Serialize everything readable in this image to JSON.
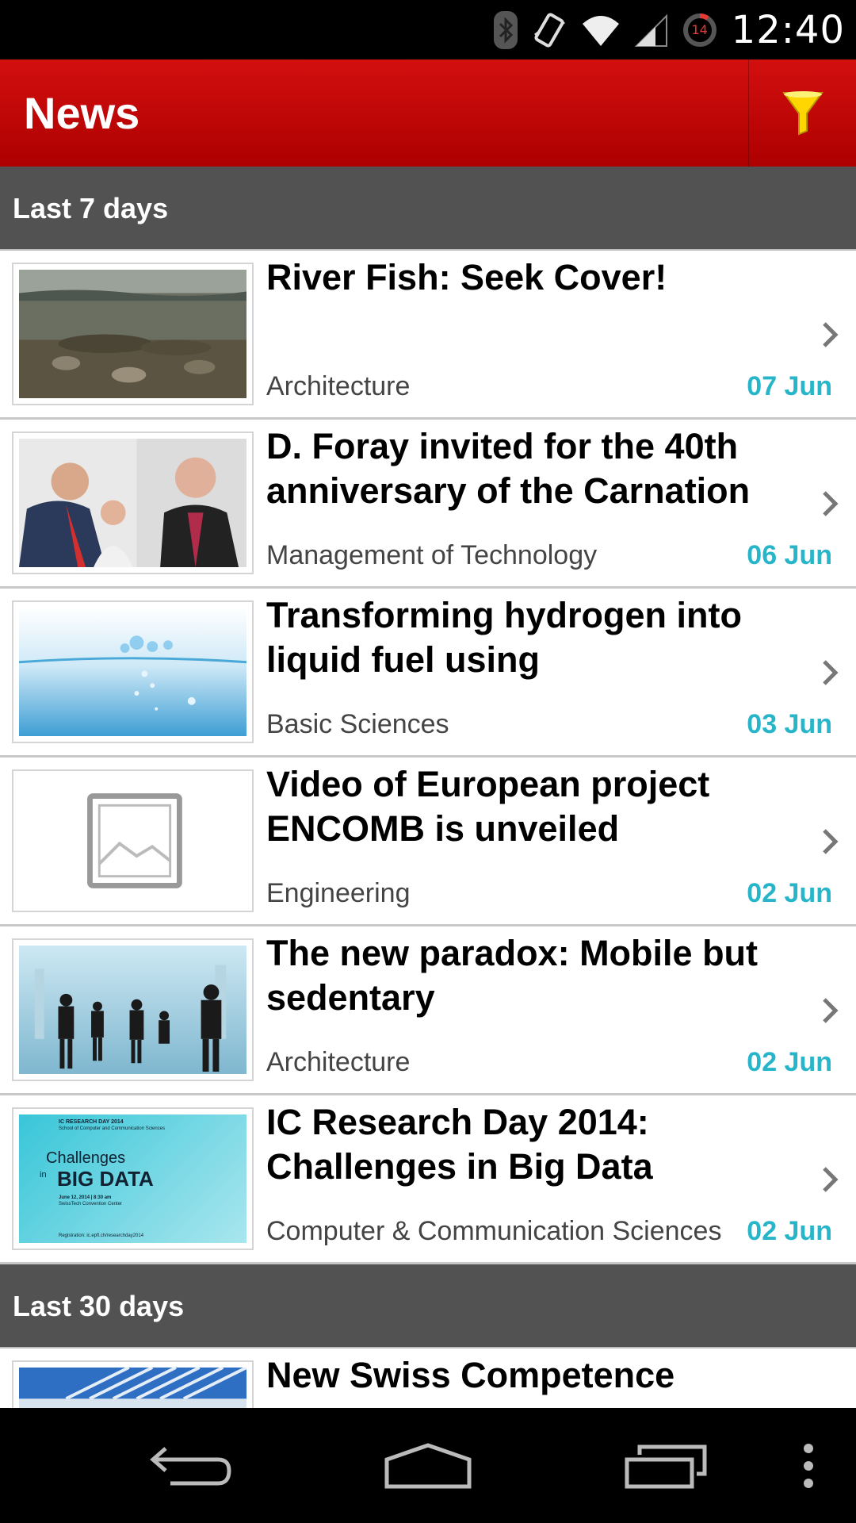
{
  "status_bar": {
    "time": "12:40",
    "battery_level": "14",
    "icons": [
      "bluetooth-icon",
      "vibrate-icon",
      "wifi-icon",
      "signal-icon",
      "battery-icon"
    ]
  },
  "app_bar": {
    "title": "News",
    "filter_icon": "filter-funnel-icon",
    "accent_color": "#c40000",
    "filter_color": "#ffd600"
  },
  "sections": [
    {
      "header": "Last 7 days",
      "items": [
        {
          "title": "River Fish: Seek Cover!",
          "category": "Architecture",
          "date": "07 Jun",
          "thumb": "river-fish-photo"
        },
        {
          "title": "D. Foray invited for the 40th anniversary of the Carnation",
          "category": "Management of Technology",
          "date": "06 Jun",
          "thumb": "people-photo"
        },
        {
          "title": "Transforming hydrogen into liquid fuel using",
          "category": "Basic Sciences",
          "date": "03 Jun",
          "thumb": "water-bubbles-photo"
        },
        {
          "title": "Video of European project ENCOMB is unveiled",
          "category": "Engineering",
          "date": "02 Jun",
          "thumb": "image-placeholder-icon"
        },
        {
          "title": "The new paradox: Mobile but sedentary",
          "category": "Architecture",
          "date": "02 Jun",
          "thumb": "commuters-photo"
        },
        {
          "title": "IC Research Day 2014: Challenges in Big Data",
          "category": "Computer & Communication Sciences",
          "date": "02 Jun",
          "thumb": "big-data-poster",
          "thumb_text": {
            "event": "IC RESEARCH DAY 2014",
            "school": "School of Computer and Communication Sciences",
            "line1": "Challenges",
            "line2": "in",
            "line3": "BIG DATA",
            "when": "June 12, 2014 | 8:30 am",
            "where": "SwissTech Convention Center",
            "registration": "Registration: ic.epfl.ch/researchday2014"
          }
        }
      ]
    },
    {
      "header": "Last 30 days",
      "items": [
        {
          "title": "New Swiss Competence",
          "category": "",
          "date": "",
          "thumb": "building-photo"
        }
      ]
    }
  ],
  "date_color": "#26b5c9",
  "nav_bar": {
    "icons": [
      "back-icon",
      "home-icon",
      "recent-apps-icon",
      "overflow-menu-icon"
    ]
  }
}
